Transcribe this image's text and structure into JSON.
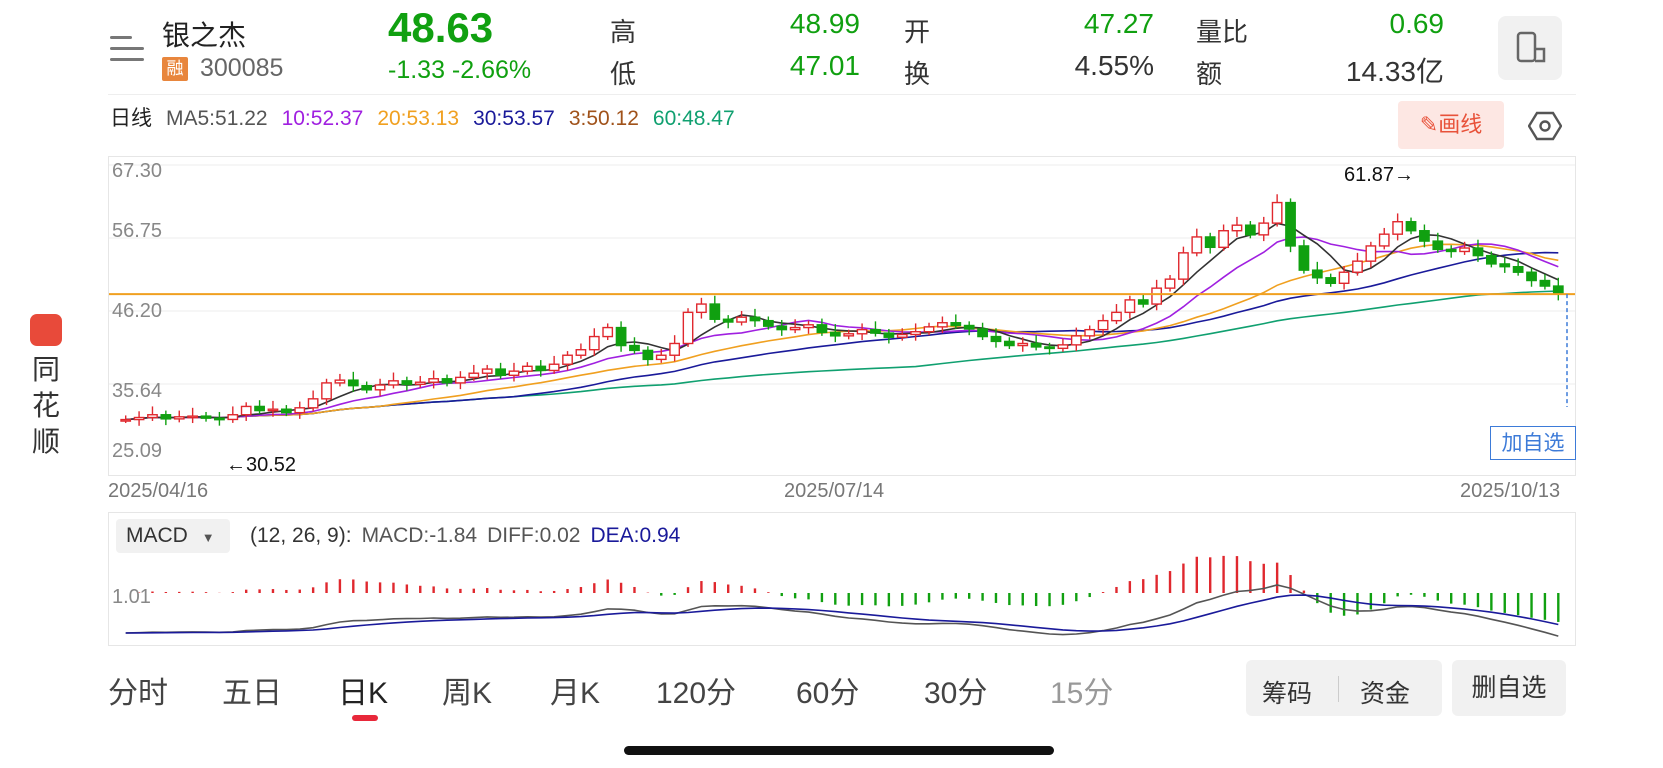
{
  "header": {
    "name": "银之杰",
    "badge": "融",
    "code": "300085",
    "price": "48.63",
    "change": "-1.33  -2.66%",
    "quotes": [
      {
        "label": "高",
        "value": "48.99",
        "color": "green"
      },
      {
        "label": "低",
        "value": "47.01",
        "color": "green"
      },
      {
        "label": "开",
        "value": "47.27",
        "color": "green"
      },
      {
        "label": "换",
        "value": "4.55%",
        "color": "dark"
      },
      {
        "label": "量比",
        "value": "0.69",
        "color": "green"
      },
      {
        "label": "额",
        "value": "14.33亿",
        "color": "dark"
      }
    ]
  },
  "indicators": {
    "period": "日线",
    "ma5": "MA5:51.22",
    "ma10": "10:52.37",
    "ma20": "20:53.13",
    "ma30": "30:53.57",
    "ma3": "3:50.12",
    "ma60": "60:48.47",
    "draw_button": "✎画线"
  },
  "chart": {
    "y_ticks": [
      "67.30",
      "56.75",
      "46.20",
      "35.64",
      "25.09"
    ],
    "dates": [
      "2025/04/16",
      "2025/07/14",
      "2025/10/13"
    ],
    "max_label": "61.87→",
    "min_label": "←30.52",
    "add_fav": "加自选",
    "current_line_price": 48.63
  },
  "macd": {
    "select": "MACD",
    "params": "(12, 26, 9):",
    "macd_val": "MACD:-1.84",
    "diff_val": "DIFF:0.02",
    "dea_val": "DEA:0.94",
    "axis": "1.01"
  },
  "tabs": [
    "分时",
    "五日",
    "日K",
    "周K",
    "月K",
    "120分",
    "60分",
    "30分",
    "15分"
  ],
  "active_tab": "日K",
  "actions": {
    "chips": "筹码",
    "funds": "资金",
    "delete": "删自选"
  },
  "side": {
    "brand": "同花顺"
  },
  "colors": {
    "up": "#e0282e",
    "down": "#10a010",
    "ma5": "#333333",
    "ma10": "#a020e0",
    "ma20": "#f0a020",
    "ma30": "#1a1a9a",
    "ma3": "#a0521a",
    "ma60": "#10a070",
    "price_line": "#f0a020"
  },
  "chart_data": {
    "type": "candlestick",
    "x": [
      "2025/04/16",
      "2025/07/14",
      "2025/10/13"
    ],
    "ylim": [
      25.09,
      67.3
    ],
    "close": [
      30.5,
      30.8,
      31.2,
      30.6,
      30.9,
      31.0,
      30.7,
      30.52,
      31.2,
      32.4,
      31.8,
      32.0,
      31.5,
      32.2,
      33.5,
      35.8,
      36.2,
      35.4,
      34.8,
      35.5,
      36.1,
      35.6,
      35.9,
      36.4,
      35.8,
      36.6,
      37.2,
      37.8,
      36.9,
      37.5,
      38.2,
      37.6,
      38.5,
      39.8,
      40.6,
      42.5,
      43.8,
      41.2,
      40.5,
      39.2,
      39.8,
      41.5,
      46.0,
      47.2,
      45.0,
      44.6,
      45.3,
      44.8,
      44.0,
      43.5,
      43.8,
      44.2,
      43.1,
      42.6,
      42.9,
      43.5,
      43.0,
      42.4,
      42.8,
      43.2,
      43.9,
      44.5,
      44.1,
      43.6,
      42.5,
      41.8,
      41.2,
      41.5,
      41.0,
      40.8,
      41.3,
      42.6,
      43.5,
      44.8,
      46.0,
      47.8,
      47.2,
      49.5,
      50.8,
      54.6,
      56.9,
      55.4,
      57.8,
      58.6,
      57.2,
      58.9,
      61.87,
      55.6,
      52.1,
      51.0,
      50.2,
      51.8,
      53.4,
      55.6,
      57.3,
      59.1,
      57.8,
      56.3,
      55.1,
      54.8,
      55.3,
      54.2,
      53.0,
      52.6,
      51.8,
      50.6,
      49.8,
      48.63
    ]
  }
}
